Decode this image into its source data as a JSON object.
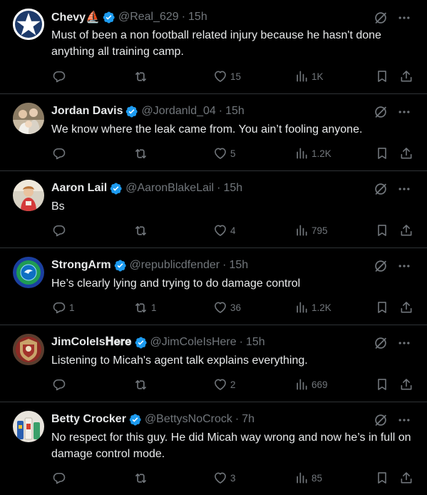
{
  "colors": {
    "background": "#000000",
    "text_primary": "#e7e9ea",
    "text_secondary": "#71767b",
    "divider": "#2f3336",
    "verified_blue": "#1d9bf0"
  },
  "tweets": [
    {
      "name": "Chevy⛵",
      "handle": "@Real_629",
      "separator": "·",
      "time": "15h",
      "text": "Must of been a non football related injury because he hasn't done anything all training camp.",
      "replies": "",
      "retweets": "",
      "likes": "15",
      "views": "1K",
      "avatar_icon": "star-avatar"
    },
    {
      "name": "Jordan Davis",
      "handle": "@Jordanld_04",
      "separator": "·",
      "time": "15h",
      "text": "We know where the leak came from. You ain’t fooling anyone.",
      "replies": "",
      "retweets": "",
      "likes": "5",
      "views": "1.2K",
      "avatar_icon": "family-photo-avatar"
    },
    {
      "name": "Aaron Lail",
      "handle": "@AaronBlakeLail",
      "separator": "·",
      "time": "15h",
      "text": "Bs",
      "replies": "",
      "retweets": "",
      "likes": "4",
      "views": "795",
      "avatar_icon": "child-photo-avatar"
    },
    {
      "name": "StrongArm",
      "handle": "@republicdfender",
      "separator": "·",
      "time": "15h",
      "text": "He’s clearly lying and trying to do damage control",
      "replies": "1",
      "retweets": "1",
      "likes": "36",
      "views": "1.2K",
      "avatar_icon": "emblem-avatar"
    },
    {
      "name": "JimColeIs𝐇𝐞𝐫𝐞",
      "handle": "@JimColeIsHere",
      "separator": "·",
      "time": "15h",
      "text": "Listening to Micah's agent talk explains everything.",
      "replies": "",
      "retweets": "",
      "likes": "2",
      "views": "669",
      "avatar_icon": "crest-avatar"
    },
    {
      "name": "Betty Crocker",
      "handle": "@BettysNoCrock",
      "separator": "·",
      "time": "7h",
      "text": "No respect for this guy. He did Micah way wrong and now he’s in full on damage control mode.",
      "replies": "",
      "retweets": "",
      "likes": "3",
      "views": "85",
      "avatar_icon": "products-photo-avatar"
    }
  ]
}
